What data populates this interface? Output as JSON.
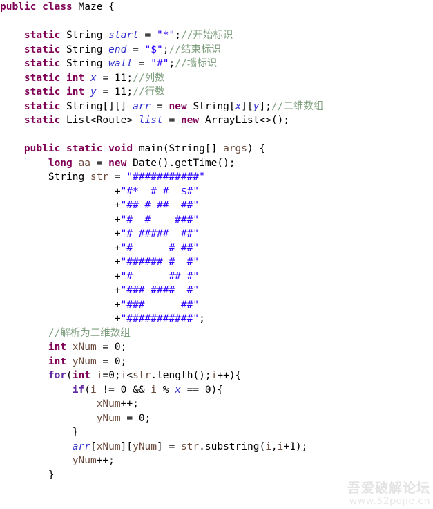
{
  "editor": {
    "language": "java",
    "class_name": "Maze",
    "background_color": "#ffffff",
    "colors": {
      "keyword": "#7f0055",
      "control_keyword": "#5f27a0",
      "field": "#3333cc",
      "local_variable": "#6a4a3c",
      "string": "#2a00ff",
      "comment": "#7f9f7f",
      "plain": "#000000"
    }
  },
  "watermark": {
    "text_cn": "吾爱破解论坛",
    "text_url": "www.52pojie.cn"
  },
  "maze_rows": [
    "###########",
    "#*  # #  $#",
    "## # ##  ##",
    "#  #    ###",
    "# #####  ##",
    "#      # ##",
    "###### #  #",
    "#      ## #",
    "### ####  #",
    "###      ##",
    "###########"
  ],
  "code_lines": [
    {
      "indent": 0,
      "tokens": [
        {
          "t": "kw",
          "v": "public"
        },
        {
          "t": "pun",
          "v": " "
        },
        {
          "t": "kw",
          "v": "class"
        },
        {
          "t": "pun",
          "v": " "
        },
        {
          "t": "typ",
          "v": "Maze"
        },
        {
          "t": "pun",
          "v": " {"
        }
      ]
    },
    {
      "indent": 0,
      "tokens": []
    },
    {
      "indent": 4,
      "tokens": [
        {
          "t": "kw",
          "v": "static"
        },
        {
          "t": "pun",
          "v": " "
        },
        {
          "t": "typ",
          "v": "String"
        },
        {
          "t": "pun",
          "v": " "
        },
        {
          "t": "fld",
          "v": "start"
        },
        {
          "t": "pun",
          "v": " = "
        },
        {
          "t": "str",
          "v": "\"*\""
        },
        {
          "t": "pun",
          "v": ";"
        },
        {
          "t": "cmt",
          "v": "//开始标识"
        }
      ]
    },
    {
      "indent": 4,
      "tokens": [
        {
          "t": "kw",
          "v": "static"
        },
        {
          "t": "pun",
          "v": " "
        },
        {
          "t": "typ",
          "v": "String"
        },
        {
          "t": "pun",
          "v": " "
        },
        {
          "t": "fld",
          "v": "end"
        },
        {
          "t": "pun",
          "v": " = "
        },
        {
          "t": "str",
          "v": "\"$\""
        },
        {
          "t": "pun",
          "v": ";"
        },
        {
          "t": "cmt",
          "v": "//结束标识"
        }
      ]
    },
    {
      "indent": 4,
      "tokens": [
        {
          "t": "kw",
          "v": "static"
        },
        {
          "t": "pun",
          "v": " "
        },
        {
          "t": "typ",
          "v": "String"
        },
        {
          "t": "pun",
          "v": " "
        },
        {
          "t": "fld",
          "v": "wall"
        },
        {
          "t": "pun",
          "v": " = "
        },
        {
          "t": "str",
          "v": "\"#\""
        },
        {
          "t": "pun",
          "v": ";"
        },
        {
          "t": "cmt",
          "v": "//墙标识"
        }
      ]
    },
    {
      "indent": 4,
      "tokens": [
        {
          "t": "kw",
          "v": "static"
        },
        {
          "t": "pun",
          "v": " "
        },
        {
          "t": "kw",
          "v": "int"
        },
        {
          "t": "pun",
          "v": " "
        },
        {
          "t": "fld",
          "v": "x"
        },
        {
          "t": "pun",
          "v": " = "
        },
        {
          "t": "num",
          "v": "11"
        },
        {
          "t": "pun",
          "v": ";"
        },
        {
          "t": "cmt",
          "v": "//列数"
        }
      ]
    },
    {
      "indent": 4,
      "tokens": [
        {
          "t": "kw",
          "v": "static"
        },
        {
          "t": "pun",
          "v": " "
        },
        {
          "t": "kw",
          "v": "int"
        },
        {
          "t": "pun",
          "v": " "
        },
        {
          "t": "fld",
          "v": "y"
        },
        {
          "t": "pun",
          "v": " = "
        },
        {
          "t": "num",
          "v": "11"
        },
        {
          "t": "pun",
          "v": ";"
        },
        {
          "t": "cmt",
          "v": "//行数"
        }
      ]
    },
    {
      "indent": 4,
      "tokens": [
        {
          "t": "kw",
          "v": "static"
        },
        {
          "t": "pun",
          "v": " "
        },
        {
          "t": "typ",
          "v": "String[][]"
        },
        {
          "t": "pun",
          "v": " "
        },
        {
          "t": "fld",
          "v": "arr"
        },
        {
          "t": "pun",
          "v": " = "
        },
        {
          "t": "kw",
          "v": "new"
        },
        {
          "t": "pun",
          "v": " "
        },
        {
          "t": "typ",
          "v": "String["
        },
        {
          "t": "fld",
          "v": "x"
        },
        {
          "t": "typ",
          "v": "]["
        },
        {
          "t": "fld",
          "v": "y"
        },
        {
          "t": "typ",
          "v": "]"
        },
        {
          "t": "pun",
          "v": ";"
        },
        {
          "t": "cmt",
          "v": "//二维数组"
        }
      ]
    },
    {
      "indent": 4,
      "tokens": [
        {
          "t": "kw",
          "v": "static"
        },
        {
          "t": "pun",
          "v": " "
        },
        {
          "t": "typ",
          "v": "List<Route>"
        },
        {
          "t": "pun",
          "v": " "
        },
        {
          "t": "fld",
          "v": "list"
        },
        {
          "t": "pun",
          "v": " = "
        },
        {
          "t": "kw",
          "v": "new"
        },
        {
          "t": "pun",
          "v": " "
        },
        {
          "t": "typ",
          "v": "ArrayList<>()"
        },
        {
          "t": "pun",
          "v": ";"
        }
      ]
    },
    {
      "indent": 0,
      "tokens": []
    },
    {
      "indent": 4,
      "tokens": [
        {
          "t": "kw",
          "v": "public"
        },
        {
          "t": "pun",
          "v": " "
        },
        {
          "t": "kw",
          "v": "static"
        },
        {
          "t": "pun",
          "v": " "
        },
        {
          "t": "kw",
          "v": "void"
        },
        {
          "t": "pun",
          "v": " "
        },
        {
          "t": "mth",
          "v": "main"
        },
        {
          "t": "pun",
          "v": "("
        },
        {
          "t": "typ",
          "v": "String[]"
        },
        {
          "t": "pun",
          "v": " "
        },
        {
          "t": "var",
          "v": "args"
        },
        {
          "t": "pun",
          "v": ") {"
        }
      ]
    },
    {
      "indent": 8,
      "tokens": [
        {
          "t": "kw",
          "v": "long"
        },
        {
          "t": "pun",
          "v": " "
        },
        {
          "t": "var",
          "v": "aa"
        },
        {
          "t": "pun",
          "v": " = "
        },
        {
          "t": "kw",
          "v": "new"
        },
        {
          "t": "pun",
          "v": " "
        },
        {
          "t": "typ",
          "v": "Date"
        },
        {
          "t": "pun",
          "v": "()."
        },
        {
          "t": "mth",
          "v": "getTime"
        },
        {
          "t": "pun",
          "v": "();"
        }
      ]
    },
    {
      "indent": 8,
      "tokens": [
        {
          "t": "typ",
          "v": "String"
        },
        {
          "t": "pun",
          "v": " "
        },
        {
          "t": "var",
          "v": "str"
        },
        {
          "t": "pun",
          "v": " = "
        },
        {
          "t": "str",
          "v": "\"###########\""
        }
      ]
    },
    {
      "indent": 19,
      "tokens": [
        {
          "t": "pun",
          "v": "+"
        },
        {
          "t": "str",
          "v": "\"#*  # #  $#\""
        }
      ]
    },
    {
      "indent": 19,
      "tokens": [
        {
          "t": "pun",
          "v": "+"
        },
        {
          "t": "str",
          "v": "\"## # ##  ##\""
        }
      ]
    },
    {
      "indent": 19,
      "tokens": [
        {
          "t": "pun",
          "v": "+"
        },
        {
          "t": "str",
          "v": "\"#  #    ###\""
        }
      ]
    },
    {
      "indent": 19,
      "tokens": [
        {
          "t": "pun",
          "v": "+"
        },
        {
          "t": "str",
          "v": "\"# #####  ##\""
        }
      ]
    },
    {
      "indent": 19,
      "tokens": [
        {
          "t": "pun",
          "v": "+"
        },
        {
          "t": "str",
          "v": "\"#      # ##\""
        }
      ]
    },
    {
      "indent": 19,
      "tokens": [
        {
          "t": "pun",
          "v": "+"
        },
        {
          "t": "str",
          "v": "\"###### #  #\""
        }
      ]
    },
    {
      "indent": 19,
      "tokens": [
        {
          "t": "pun",
          "v": "+"
        },
        {
          "t": "str",
          "v": "\"#      ## #\""
        }
      ]
    },
    {
      "indent": 19,
      "tokens": [
        {
          "t": "pun",
          "v": "+"
        },
        {
          "t": "str",
          "v": "\"### ####  #\""
        }
      ]
    },
    {
      "indent": 19,
      "tokens": [
        {
          "t": "pun",
          "v": "+"
        },
        {
          "t": "str",
          "v": "\"###      ##\""
        }
      ]
    },
    {
      "indent": 19,
      "tokens": [
        {
          "t": "pun",
          "v": "+"
        },
        {
          "t": "str",
          "v": "\"###########\""
        },
        {
          "t": "pun",
          "v": ";"
        }
      ]
    },
    {
      "indent": 8,
      "tokens": [
        {
          "t": "cmt",
          "v": "//解析为二维数组"
        }
      ]
    },
    {
      "indent": 8,
      "tokens": [
        {
          "t": "kw",
          "v": "int"
        },
        {
          "t": "pun",
          "v": " "
        },
        {
          "t": "var",
          "v": "xNum"
        },
        {
          "t": "pun",
          "v": " = "
        },
        {
          "t": "num",
          "v": "0"
        },
        {
          "t": "pun",
          "v": ";"
        }
      ]
    },
    {
      "indent": 8,
      "tokens": [
        {
          "t": "kw",
          "v": "int"
        },
        {
          "t": "pun",
          "v": " "
        },
        {
          "t": "var",
          "v": "yNum"
        },
        {
          "t": "pun",
          "v": " = "
        },
        {
          "t": "num",
          "v": "0"
        },
        {
          "t": "pun",
          "v": ";"
        }
      ]
    },
    {
      "indent": 8,
      "tokens": [
        {
          "t": "kw2",
          "v": "for"
        },
        {
          "t": "pun",
          "v": "("
        },
        {
          "t": "kw",
          "v": "int"
        },
        {
          "t": "pun",
          "v": " "
        },
        {
          "t": "var",
          "v": "i"
        },
        {
          "t": "pun",
          "v": "="
        },
        {
          "t": "num",
          "v": "0"
        },
        {
          "t": "pun",
          "v": ";"
        },
        {
          "t": "var",
          "v": "i"
        },
        {
          "t": "pun",
          "v": "<"
        },
        {
          "t": "var",
          "v": "str"
        },
        {
          "t": "pun",
          "v": "."
        },
        {
          "t": "mth",
          "v": "length"
        },
        {
          "t": "pun",
          "v": "();"
        },
        {
          "t": "var",
          "v": "i"
        },
        {
          "t": "pun",
          "v": "++){"
        }
      ]
    },
    {
      "indent": 12,
      "tokens": [
        {
          "t": "kw2",
          "v": "if"
        },
        {
          "t": "pun",
          "v": "("
        },
        {
          "t": "var",
          "v": "i"
        },
        {
          "t": "pun",
          "v": " != "
        },
        {
          "t": "num",
          "v": "0"
        },
        {
          "t": "pun",
          "v": " && "
        },
        {
          "t": "var",
          "v": "i"
        },
        {
          "t": "pun",
          "v": " % "
        },
        {
          "t": "fld",
          "v": "x"
        },
        {
          "t": "pun",
          "v": " == "
        },
        {
          "t": "num",
          "v": "0"
        },
        {
          "t": "pun",
          "v": "){"
        }
      ]
    },
    {
      "indent": 16,
      "tokens": [
        {
          "t": "var",
          "v": "xNum"
        },
        {
          "t": "pun",
          "v": "++;"
        }
      ]
    },
    {
      "indent": 16,
      "tokens": [
        {
          "t": "var",
          "v": "yNum"
        },
        {
          "t": "pun",
          "v": " = "
        },
        {
          "t": "num",
          "v": "0"
        },
        {
          "t": "pun",
          "v": ";"
        }
      ]
    },
    {
      "indent": 12,
      "tokens": [
        {
          "t": "pun",
          "v": "}"
        }
      ]
    },
    {
      "indent": 12,
      "tokens": [
        {
          "t": "fld",
          "v": "arr"
        },
        {
          "t": "pun",
          "v": "["
        },
        {
          "t": "var",
          "v": "xNum"
        },
        {
          "t": "pun",
          "v": "]["
        },
        {
          "t": "var",
          "v": "yNum"
        },
        {
          "t": "pun",
          "v": "] = "
        },
        {
          "t": "var",
          "v": "str"
        },
        {
          "t": "pun",
          "v": "."
        },
        {
          "t": "mth",
          "v": "substring"
        },
        {
          "t": "pun",
          "v": "("
        },
        {
          "t": "var",
          "v": "i"
        },
        {
          "t": "pun",
          "v": ","
        },
        {
          "t": "var",
          "v": "i"
        },
        {
          "t": "pun",
          "v": "+"
        },
        {
          "t": "num",
          "v": "1"
        },
        {
          "t": "pun",
          "v": ");"
        }
      ]
    },
    {
      "indent": 12,
      "tokens": [
        {
          "t": "var",
          "v": "yNum"
        },
        {
          "t": "pun",
          "v": "++;"
        }
      ]
    },
    {
      "indent": 8,
      "tokens": [
        {
          "t": "pun",
          "v": "}"
        }
      ]
    }
  ]
}
